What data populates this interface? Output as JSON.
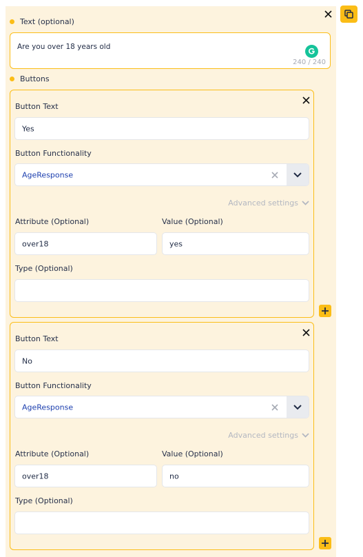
{
  "text_section": {
    "label": "Text (optional)",
    "value": "Are you over 18 years old",
    "counter": "240 / 240"
  },
  "buttons_section": {
    "label": "Buttons",
    "cards": [
      {
        "button_text_label": "Button Text",
        "button_text_value": "Yes",
        "functionality_label": "Button Functionality",
        "functionality_value": "AgeResponse",
        "advanced_label": "Advanced settings",
        "attribute_label": "Attribute (Optional)",
        "attribute_value": "over18",
        "value_label": "Value (Optional)",
        "value_value": "yes",
        "type_label": "Type (Optional)",
        "type_value": ""
      },
      {
        "button_text_label": "Button Text",
        "button_text_value": "No",
        "functionality_label": "Button Functionality",
        "functionality_value": "AgeResponse",
        "advanced_label": "Advanced settings",
        "attribute_label": "Attribute (Optional)",
        "attribute_value": "over18",
        "value_label": "Value (Optional)",
        "value_value": "no",
        "type_label": "Type (Optional)",
        "type_value": ""
      }
    ]
  },
  "colors": {
    "accent": "#fbbd17",
    "panel_bg": "#fdf3de",
    "link_blue": "#1e40af"
  },
  "icons": [
    "duplicate-icon",
    "close-icon",
    "grammarly-icon",
    "clear-icon",
    "chevron-down-icon",
    "plus-icon"
  ]
}
